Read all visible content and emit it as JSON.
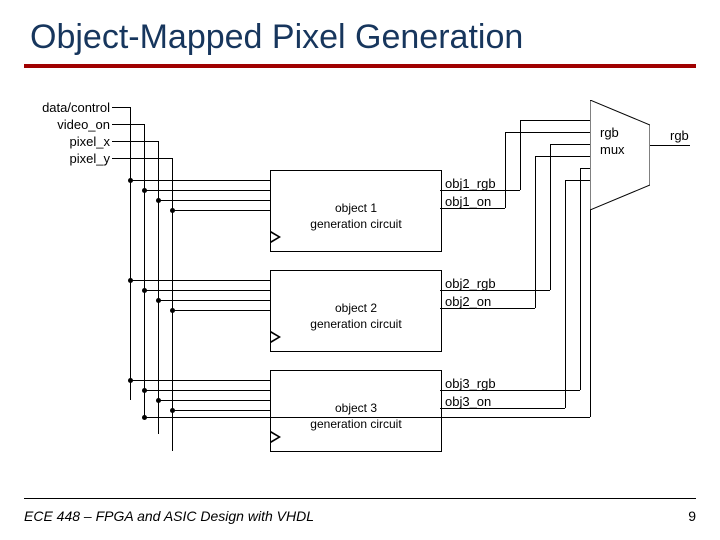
{
  "title": "Object-Mapped Pixel Generation",
  "footer": {
    "course": "ECE 448 – FPGA and ASIC Design with VHDL",
    "page": "9"
  },
  "inputs": {
    "data_control": "data/control",
    "video_on": "video_on",
    "pixel_x": "pixel_x",
    "pixel_y": "pixel_y"
  },
  "blocks": {
    "obj1": {
      "line1": "object 1",
      "line2": "generation circuit"
    },
    "obj2": {
      "line1": "object 2",
      "line2": "generation circuit"
    },
    "obj3": {
      "line1": "object 3",
      "line2": "generation circuit"
    }
  },
  "signals": {
    "obj1_rgb": "obj1_rgb",
    "obj1_on": "obj1_on",
    "obj2_rgb": "obj2_rgb",
    "obj2_on": "obj2_on",
    "obj3_rgb": "obj3_rgb",
    "obj3_on": "obj3_on"
  },
  "mux": {
    "line1": "rgb",
    "line2": "mux"
  },
  "output": {
    "rgb": "rgb"
  }
}
